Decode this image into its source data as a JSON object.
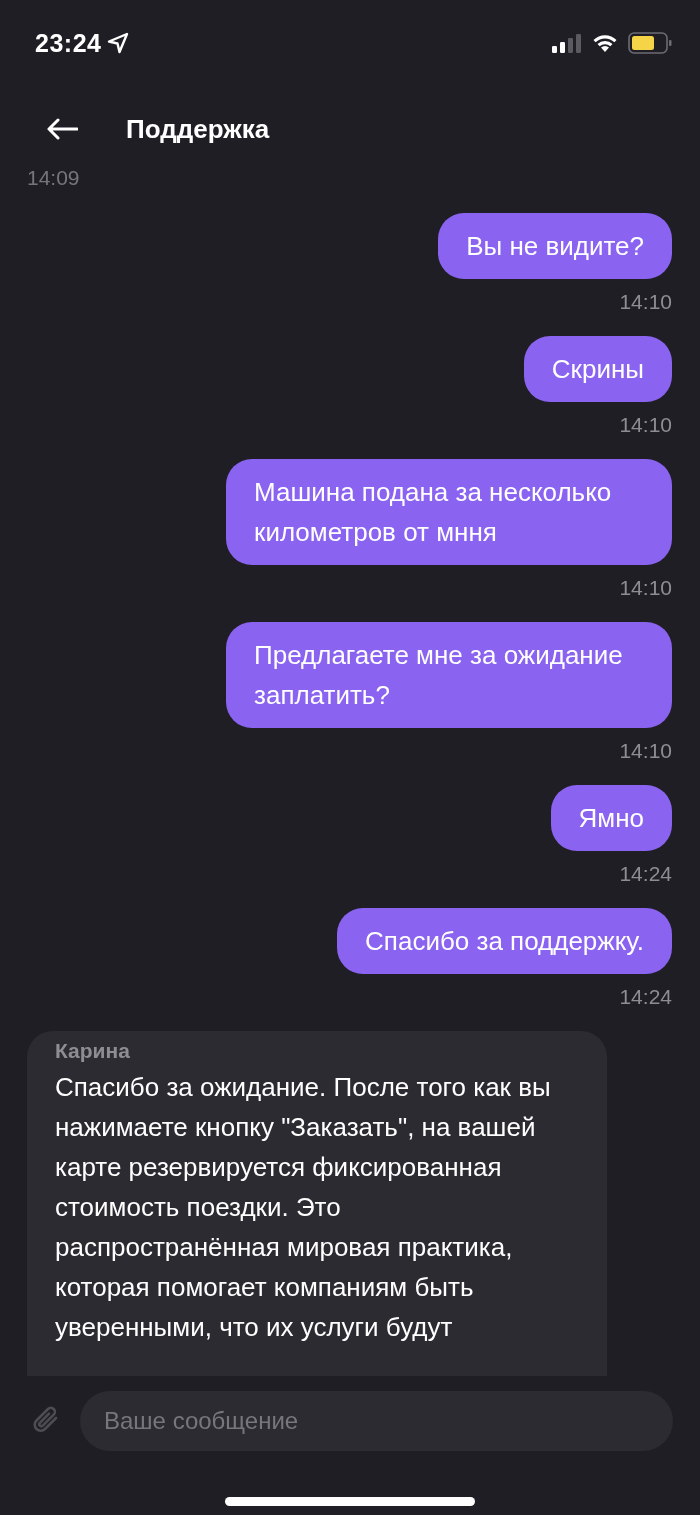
{
  "status_bar": {
    "time": "23:24"
  },
  "header": {
    "title": "Поддержка"
  },
  "messages": [
    {
      "kind": "timestamp",
      "time": "14:09"
    },
    {
      "kind": "outgoing",
      "text": "Вы не видите?",
      "time": "14:10"
    },
    {
      "kind": "outgoing",
      "text": "Скрины",
      "time": "14:10"
    },
    {
      "kind": "outgoing",
      "text": "Машина подана за несколько километров от мння",
      "time": "14:10"
    },
    {
      "kind": "outgoing",
      "text": "Предлагаете мне за ожидание заплатить?",
      "time": "14:10"
    },
    {
      "kind": "outgoing",
      "text": "Ямно",
      "time": "14:24"
    },
    {
      "kind": "outgoing",
      "text": "Спасибо за поддержку.",
      "time": "14:24"
    },
    {
      "kind": "incoming",
      "sender": "Карина",
      "text": "Спасибо за ожидание. После того как вы нажимаете кнопку \"Заказать\", на вашей карте резервируется фиксированная стоимость поездки. Это распространённая мировая практика, которая помогает компаниям быть уверенными, что их услуги будут"
    }
  ],
  "composer": {
    "placeholder": "Ваше сообщение"
  }
}
